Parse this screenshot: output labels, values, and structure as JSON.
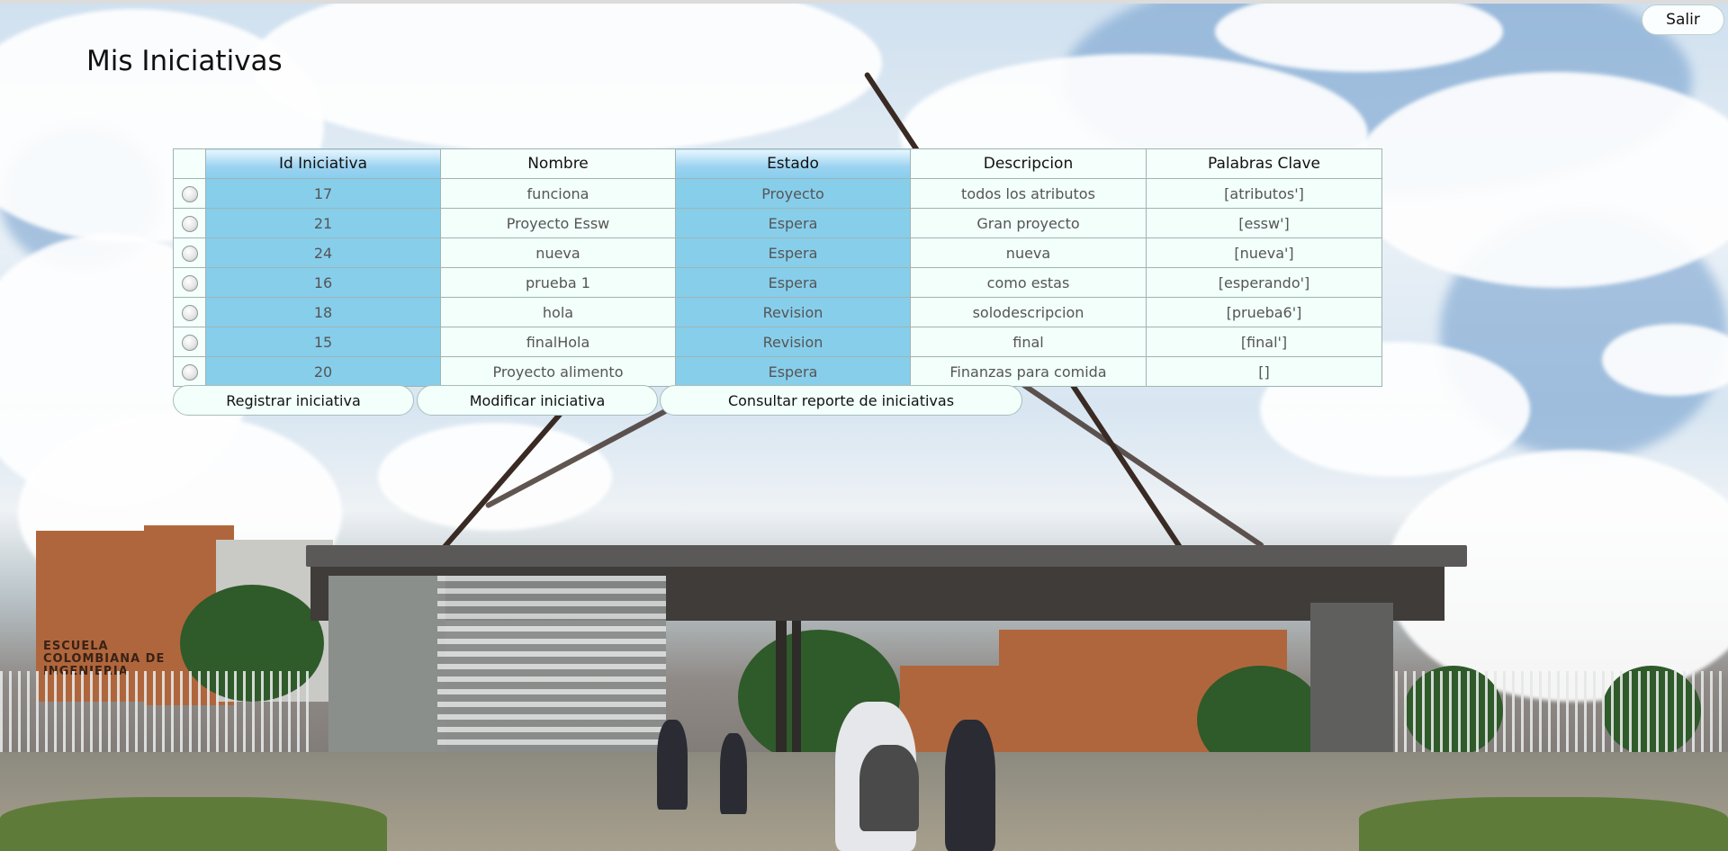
{
  "header": {
    "logout_label": "Salir"
  },
  "page": {
    "title": "Mis Iniciativas"
  },
  "table": {
    "columns": [
      "Id Iniciativa",
      "Nombre",
      "Estado",
      "Descripcion",
      "Palabras Clave"
    ],
    "rows": [
      {
        "id": "17",
        "nombre": "funciona",
        "estado": "Proyecto",
        "descripcion": "todos los atributos",
        "palabras": "[atributos']"
      },
      {
        "id": "21",
        "nombre": "Proyecto Essw",
        "estado": "Espera",
        "descripcion": "Gran proyecto",
        "palabras": "[essw']"
      },
      {
        "id": "24",
        "nombre": "nueva",
        "estado": "Espera",
        "descripcion": "nueva",
        "palabras": "[nueva']"
      },
      {
        "id": "16",
        "nombre": "prueba 1",
        "estado": "Espera",
        "descripcion": "como estas",
        "palabras": "[esperando']"
      },
      {
        "id": "18",
        "nombre": "hola",
        "estado": "Revision",
        "descripcion": "solodescripcion",
        "palabras": "[prueba6']"
      },
      {
        "id": "15",
        "nombre": "finalHola",
        "estado": "Revision",
        "descripcion": "final",
        "palabras": "[final']"
      },
      {
        "id": "20",
        "nombre": "Proyecto alimento",
        "estado": "Espera",
        "descripcion": "Finanzas para comida",
        "palabras": "[]"
      }
    ]
  },
  "actions": {
    "register": "Registrar iniciativa",
    "modify": "Modificar iniciativa",
    "report": "Consultar reporte de iniciativas"
  },
  "background": {
    "sign_text": "ESCUELA COLOMBIANA DE INGENIERIA"
  },
  "colors": {
    "highlight_column": "#87ceeb",
    "cell_background": "#f2fffa"
  }
}
